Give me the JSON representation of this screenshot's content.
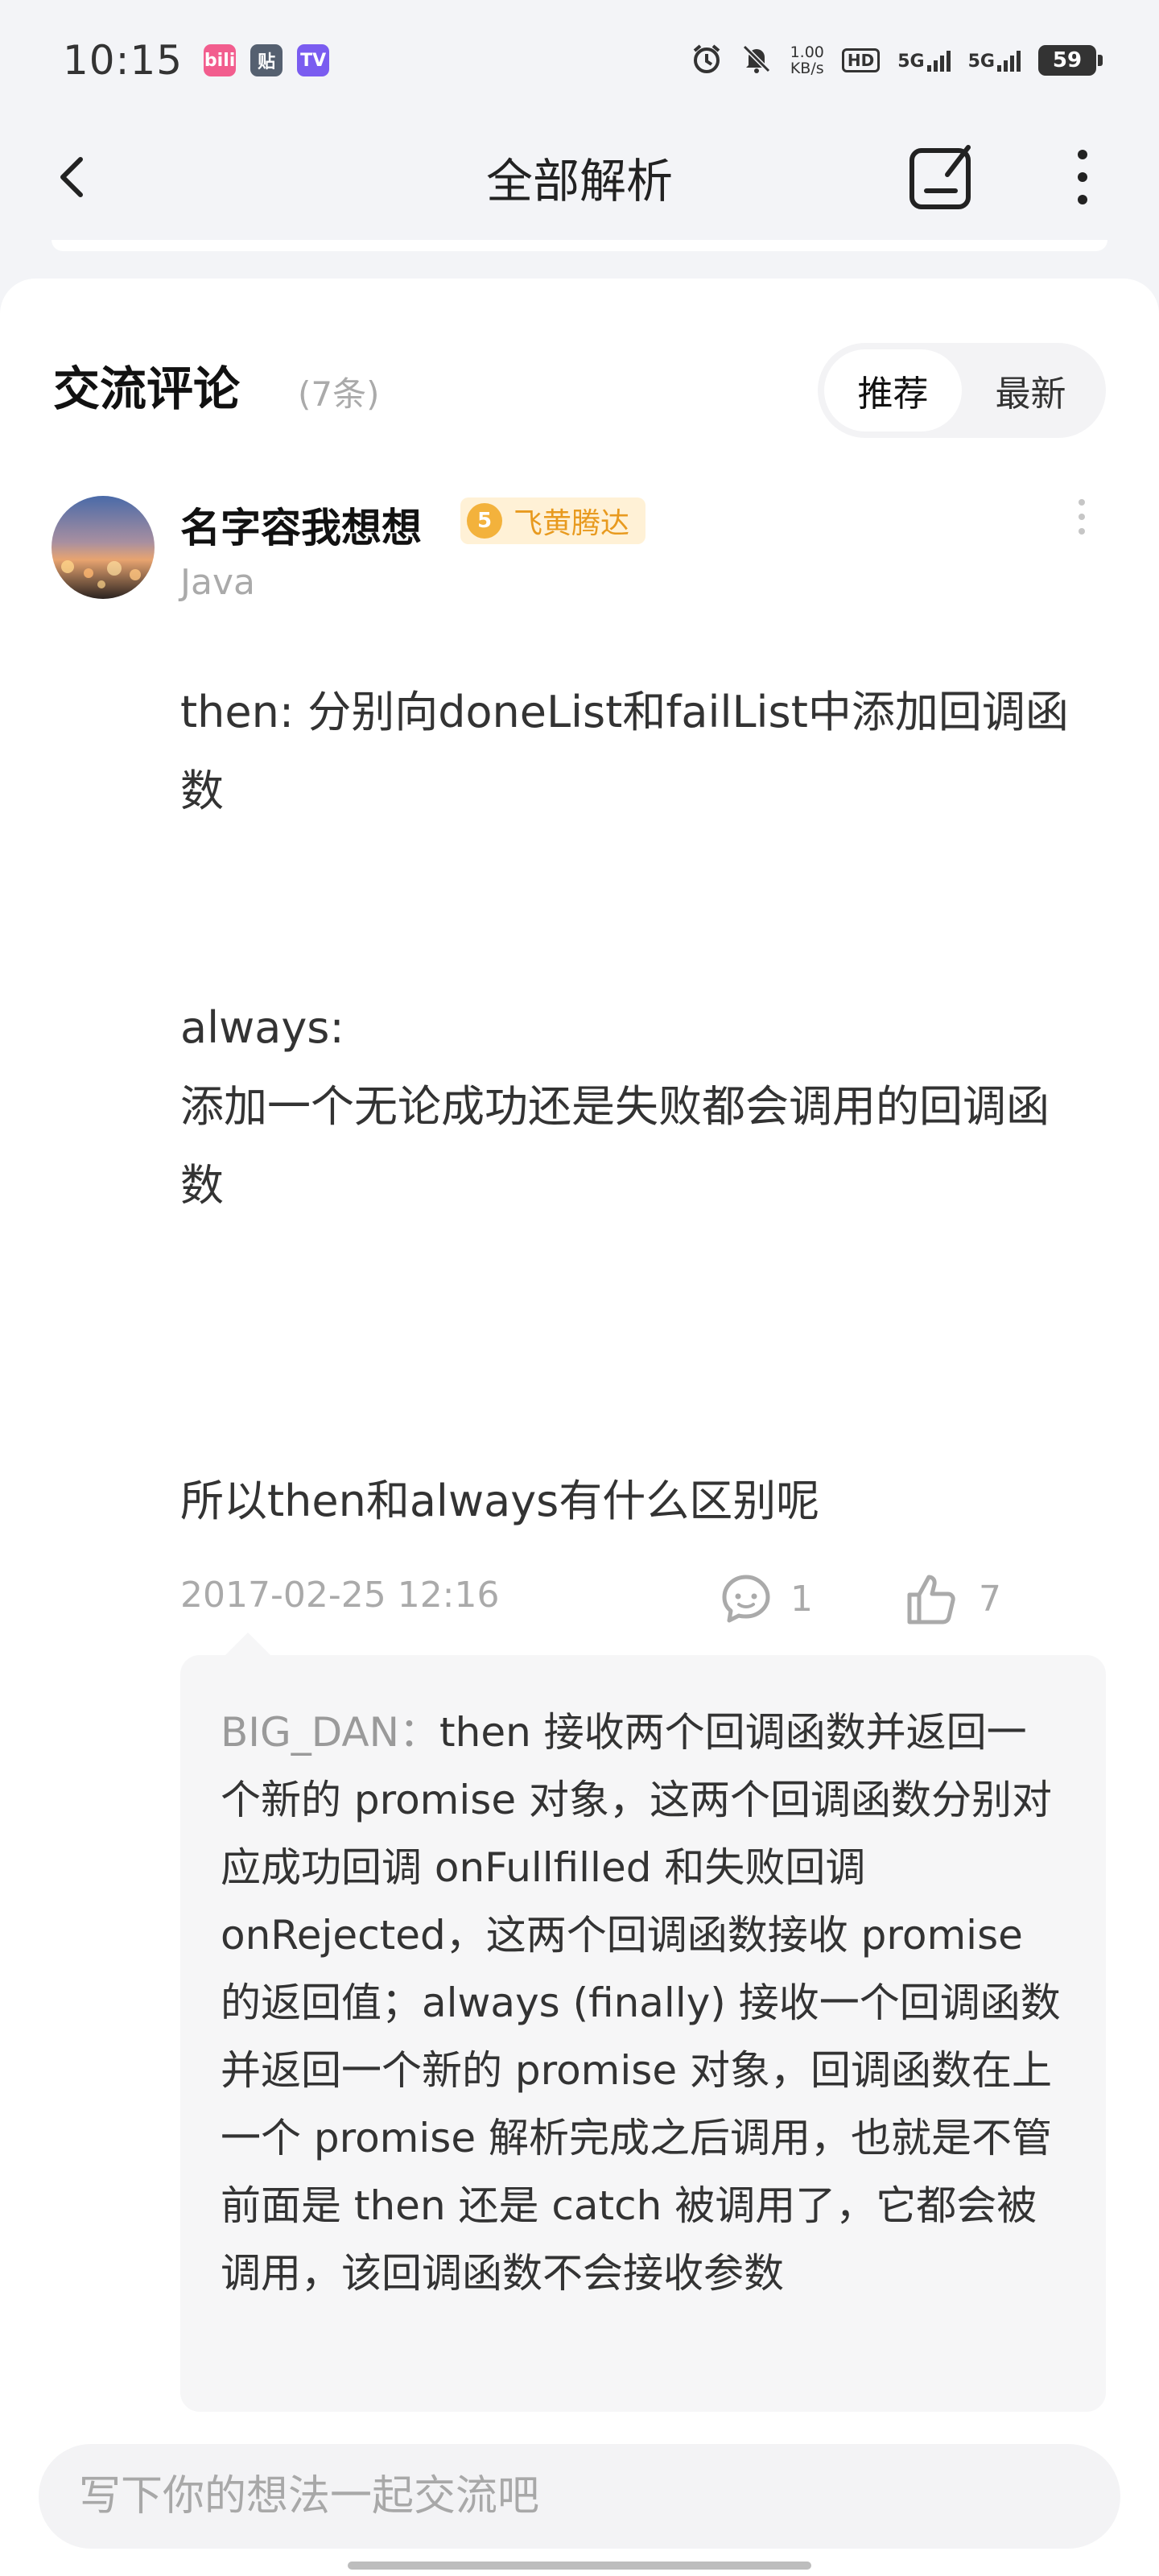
{
  "status_bar": {
    "time": "10:15",
    "app_icons": [
      {
        "label": "bili",
        "color": "#f25d8e"
      },
      {
        "label": "贴",
        "color": "#556070"
      },
      {
        "label": "TV",
        "color": "#7a5cf0"
      }
    ],
    "speed_value": "1.00",
    "speed_unit": "KB/s",
    "hd_label": "HD",
    "signal_1": "5G",
    "signal_2": "5G",
    "battery": "59"
  },
  "header": {
    "title": "全部解析",
    "icons": [
      "back-arrow-icon",
      "edit-note-icon",
      "more-vertical-icon"
    ]
  },
  "comments": {
    "title": "交流评论",
    "count": "(7条)",
    "sort_options": [
      "推荐",
      "最新"
    ],
    "active_sort": "推荐"
  },
  "comment": {
    "username": "名字容我想想",
    "level_number": "5",
    "level_name": "飞黄腾达",
    "tag": "Java",
    "body_lines": [
      "  then: 分别向doneList和failList中添加回调函数",
      "",
      "",
      "always:",
      "添加一个无论成功还是失败都会调用的回调函数",
      "",
      "",
      "",
      "所以then和always有什么区别呢"
    ],
    "date": "2017-02-25 12:16",
    "reply_count": "1",
    "like_count": "7"
  },
  "reply": {
    "author": "BIG_DAN：",
    "text": "then 接收两个回调函数并返回一个新的 promise 对象，这两个回调函数分别对应成功回调 onFullfilled 和失败回调 onRejected，这两个回调函数接收 promise 的返回值；always (finally) 接收一个回调函数并返回一个新的 promise 对象，回调函数在上一个 promise 解析完成之后调用，也就是不管前面是 then 还是 catch 被调用了，它都会被调用，该回调函数不会接收参数"
  },
  "input": {
    "placeholder": "写下你的想法一起交流吧"
  },
  "colors": {
    "accent_badge": "#f3b23c",
    "badge_bg": "#fff1d6",
    "muted_text": "#aaaaaa"
  }
}
